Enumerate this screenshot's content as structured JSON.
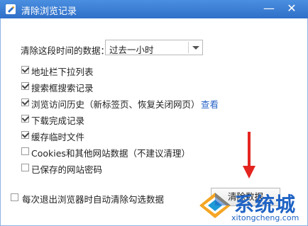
{
  "window": {
    "title": "清除浏览记录",
    "minimize_symbol": "—",
    "close_symbol": "✕"
  },
  "time_range": {
    "label": "清除这段时间的数据：",
    "selected": "过去一小时"
  },
  "options": [
    {
      "label": "地址栏下拉列表",
      "checked": true
    },
    {
      "label": "搜索框搜索记录",
      "checked": true
    },
    {
      "label": "浏览访问历史（新标签页、恢复关闭网页）",
      "checked": true
    },
    {
      "label": "下载完成记录",
      "checked": true
    },
    {
      "label": "缓存临时文件",
      "checked": true
    },
    {
      "label": "Cookies和其他网站数据（不建议清理）",
      "checked": false
    },
    {
      "label": "已保存的网站密码",
      "checked": false
    }
  ],
  "view_link": "查看",
  "auto_clear": {
    "label": "每次退出浏览器时自动清除勾选数据",
    "checked": false
  },
  "clear_button": "清除数据",
  "watermark": {
    "name": "系统城",
    "url": "xitongcheng.com"
  },
  "colors": {
    "titlebar": "#2f6fc8",
    "link": "#2a63c7",
    "annotation_arrow": "#e4241f"
  }
}
